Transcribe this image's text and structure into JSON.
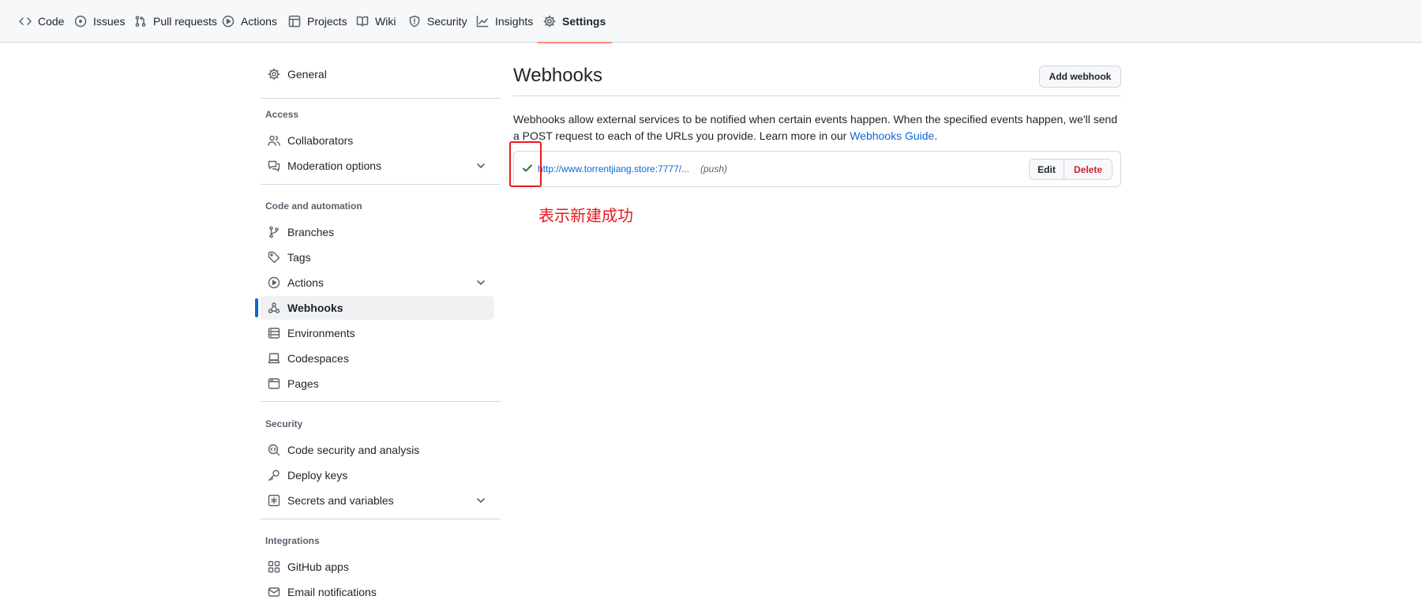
{
  "nav": {
    "tabs": [
      {
        "label": "Code",
        "icon": "code-icon"
      },
      {
        "label": "Issues",
        "icon": "issue-opened-icon"
      },
      {
        "label": "Pull requests",
        "icon": "git-pull-request-icon"
      },
      {
        "label": "Actions",
        "icon": "play-icon"
      },
      {
        "label": "Projects",
        "icon": "table-icon"
      },
      {
        "label": "Wiki",
        "icon": "book-icon"
      },
      {
        "label": "Security",
        "icon": "shield-icon"
      },
      {
        "label": "Insights",
        "icon": "graph-icon"
      },
      {
        "label": "Settings",
        "icon": "gear-icon",
        "selected": true
      }
    ]
  },
  "sidebar": {
    "general": "General",
    "access_title": "Access",
    "collaborators": "Collaborators",
    "moderation": "Moderation options",
    "automation_title": "Code and automation",
    "branches": "Branches",
    "tags": "Tags",
    "actions": "Actions",
    "webhooks": "Webhooks",
    "environments": "Environments",
    "codespaces": "Codespaces",
    "pages": "Pages",
    "security_title": "Security",
    "code_security": "Code security and analysis",
    "deploy_keys": "Deploy keys",
    "secrets": "Secrets and variables",
    "integrations_title": "Integrations",
    "github_apps": "GitHub apps",
    "email_notifications": "Email notifications"
  },
  "main": {
    "title": "Webhooks",
    "add_button": "Add webhook",
    "description": "Webhooks allow external services to be notified when certain events happen. When the specified events happen, we'll send a POST request to each of the URLs you provide. Learn more in our ",
    "guide_link": "Webhooks Guide",
    "description_end": ".",
    "hook": {
      "url": "http://www.torrentjiang.store:7777/...",
      "events": "(push)",
      "status": "success",
      "edit_label": "Edit",
      "delete_label": "Delete"
    }
  },
  "annotation": {
    "text": "表示新建成功",
    "color": "#e8191e"
  },
  "colors": {
    "accent": "#0969da",
    "selected_underline": "#fd8c73",
    "success": "#1a7f37",
    "danger": "#cf222e"
  }
}
